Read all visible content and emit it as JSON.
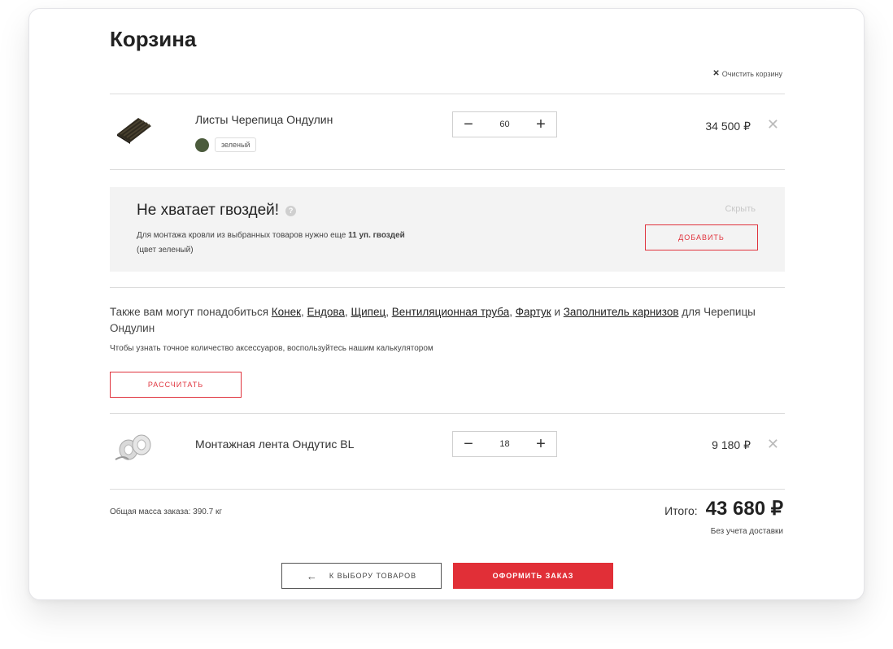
{
  "page": {
    "title": "Корзина",
    "clear_label": "Очистить корзину"
  },
  "items": [
    {
      "name": "Листы Черепица Ондулин",
      "color_label": "зеленый",
      "color": "#4b5b3c",
      "quantity": "60",
      "price": "34 500 ₽"
    },
    {
      "name": "Монтажная лента Ондутис BL",
      "quantity": "18",
      "price": "9 180 ₽"
    }
  ],
  "nails": {
    "heading": "Не хватает гвоздей!",
    "help_icon": "?",
    "text_pre": "Для монтажа кровли из выбранных товаров нужно еще ",
    "text_bold": "11 уп. гвоздей",
    "text_line2": "(цвет зеленый)",
    "hide_label": "Скрыть",
    "add_label": "ДОБАВИТЬ"
  },
  "accessories": {
    "intro": "Также вам могут понадобиться ",
    "links": [
      "Конек",
      "Ендова",
      "Щипец",
      "Вентиляционная труба",
      "Фартук",
      "Заполнитель карнизов"
    ],
    "and_word": " и ",
    "suffix": " для Черепицы Ондулин",
    "note": "Чтобы узнать точное количество аксессуаров, воспользуйтесь нашим калькулятором",
    "calc_label": "РАССЧИТАТЬ"
  },
  "summary": {
    "mass_label": "Общая масса заказа:",
    "mass_value": "390.7 кг",
    "total_label": "Итого:",
    "total_value": "43 680 ₽",
    "delivery_note": "Без учета доставки"
  },
  "actions": {
    "back_label": "К ВЫБОРУ ТОВАРОВ",
    "order_label": "ОФОРМИТЬ ЗАКАЗ"
  },
  "colors": {
    "accent": "#e12f37",
    "panel": "#f3f3f3"
  },
  "icons": {
    "clear": "close-icon",
    "remove": "close-icon",
    "back": "arrow-left-icon",
    "help": "question-icon",
    "minus": "minus-icon",
    "plus": "plus-icon"
  }
}
